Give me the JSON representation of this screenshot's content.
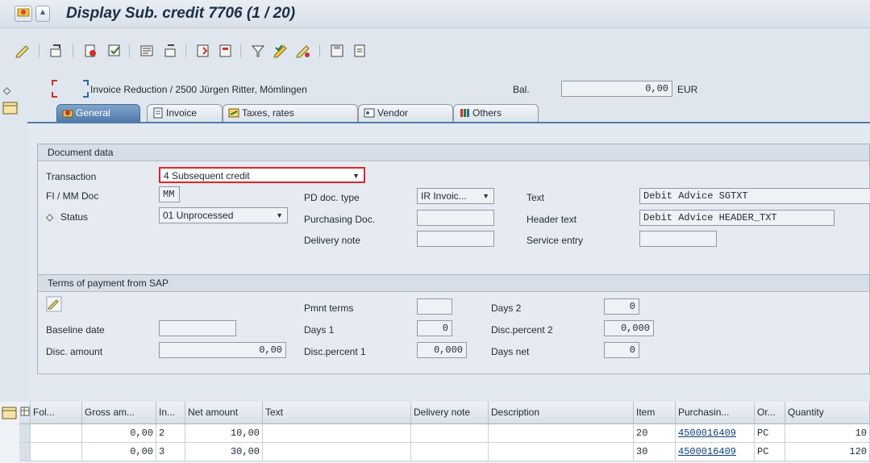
{
  "window": {
    "title": "Display Sub. credit 7706 (1 / 20)"
  },
  "toolbar": {
    "icons": [
      "edit-icon",
      "display-change-icon",
      "hold-icon",
      "simulate-icon",
      "messages-icon",
      "display-doc-icon",
      "new-doc-icon",
      "delete-icon",
      "filter-icon",
      "check-icon",
      "forward-icon",
      "save-icon",
      "print-icon"
    ]
  },
  "header": {
    "doc_line": "Invoice Reduction / 2500 Jürgen Ritter, Mömlingen",
    "balance_label": "Bal.",
    "balance_value": "0,00",
    "currency": "EUR"
  },
  "tabs": [
    {
      "label": "General",
      "active": true
    },
    {
      "label": "Invoice",
      "active": false
    },
    {
      "label": "Taxes, rates",
      "active": false
    },
    {
      "label": "Vendor",
      "active": false
    },
    {
      "label": "Others",
      "active": false
    }
  ],
  "document_data": {
    "title": "Document data",
    "transaction_label": "Transaction",
    "transaction_value": "4 Subsequent credit",
    "fimm_label": "FI / MM Doc",
    "fimm_value": "MM",
    "status_label": "Status",
    "status_value": "01 Unprocessed",
    "pd_doc_type_label": "PD doc. type",
    "pd_doc_type_value": "IR Invoic...",
    "purchasing_doc_label": "Purchasing Doc.",
    "purchasing_doc_value": "",
    "delivery_note_label": "Delivery note",
    "delivery_note_value": "",
    "text_label": "Text",
    "text_value": "Debit Advice SGTXT",
    "header_text_label": "Header text",
    "header_text_value": "Debit Advice HEADER_TXT",
    "service_entry_label": "Service entry",
    "service_entry_value": ""
  },
  "terms": {
    "title": "Terms of payment from SAP",
    "baseline_date_label": "Baseline date",
    "baseline_date_value": "",
    "disc_amount_label": "Disc. amount",
    "disc_amount_value": "0,00",
    "pmnt_terms_label": "Pmnt terms",
    "pmnt_terms_value": "",
    "days1_label": "Days 1",
    "days1_value": "0",
    "disc_percent1_label": "Disc.percent 1",
    "disc_percent1_value": "0,000",
    "days2_label": "Days 2",
    "days2_value": "0",
    "disc_percent2_label": "Disc.percent 2",
    "disc_percent2_value": "0,000",
    "days_net_label": "Days net",
    "days_net_value": "0"
  },
  "table": {
    "columns": [
      "Fol...",
      "Gross am...",
      "In...",
      "Net amount",
      "Text",
      "Delivery note",
      "Description",
      "Item",
      "Purchasin...",
      "Or...",
      "Quantity"
    ],
    "rows": [
      {
        "fol": "",
        "gross": "0,00",
        "in": "2",
        "net": "10,00",
        "text": "",
        "delivery": "",
        "description": "",
        "item": "20",
        "purchasing": "4500016409",
        "order_unit": "PC",
        "quantity": "10"
      },
      {
        "fol": "",
        "gross": "0,00",
        "in": "3",
        "net": "30,00",
        "text": "",
        "delivery": "",
        "description": "",
        "item": "30",
        "purchasing": "4500016409",
        "order_unit": "PC",
        "quantity": "120"
      }
    ]
  },
  "colors": {
    "accent": "#4f7cab",
    "highlight_box": "#e0242a"
  }
}
